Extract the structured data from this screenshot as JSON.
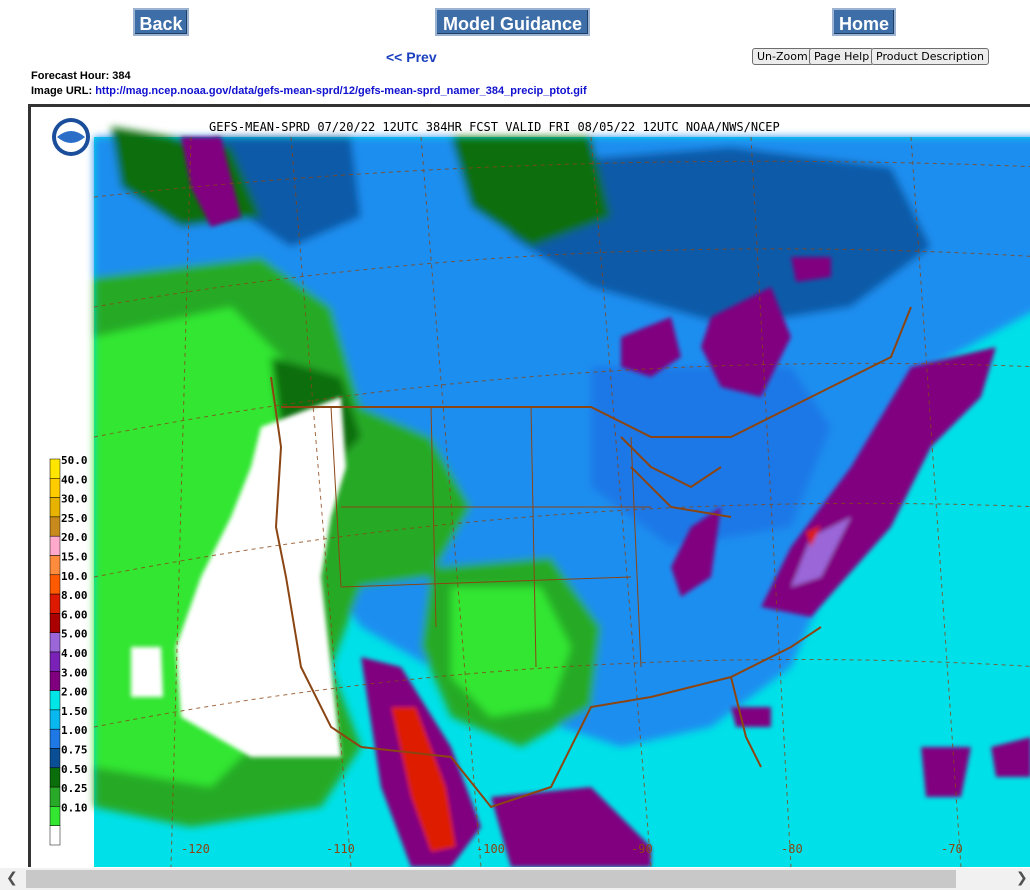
{
  "nav": {
    "back": "Back",
    "model_guidance": "Model Guidance",
    "home": "Home",
    "prev": "<< Prev"
  },
  "buttons": {
    "unzoom": "Un-Zoom",
    "page_help": "Page Help",
    "product_description": "Product Description"
  },
  "info": {
    "forecast_hour": "Forecast Hour: 384",
    "image_url_label": "Image URL:",
    "image_url": "http://mag.ncep.noaa.gov/data/gefs-mean-sprd/12/gefs-mean-sprd_namer_384_precip_ptot.gif"
  },
  "map": {
    "title": "GEFS-MEAN-SPRD 07/20/22 12UTC 384HR FCST VALID FRI 08/05/22 12UTC NOAA/NWS/NCEP",
    "legend": [
      {
        "label": "50.0",
        "color": "#ffe600"
      },
      {
        "label": "40.0",
        "color": "#ffcc00"
      },
      {
        "label": "30.0",
        "color": "#e7b200"
      },
      {
        "label": "25.0",
        "color": "#c88a1c"
      },
      {
        "label": "20.0",
        "color": "#ffaacc"
      },
      {
        "label": "15.0",
        "color": "#ff8c3c"
      },
      {
        "label": "10.0",
        "color": "#ff5a00"
      },
      {
        "label": "8.00",
        "color": "#dd1a00"
      },
      {
        "label": "6.00",
        "color": "#aa0000"
      },
      {
        "label": "5.00",
        "color": "#9a66d8"
      },
      {
        "label": "4.00",
        "color": "#7a22b8"
      },
      {
        "label": "3.00",
        "color": "#800080"
      },
      {
        "label": "2.00",
        "color": "#00e5e5"
      },
      {
        "label": "1.50",
        "color": "#0ab8f0"
      },
      {
        "label": "1.00",
        "color": "#1e78e6"
      },
      {
        "label": "0.75",
        "color": "#0a4f96"
      },
      {
        "label": "0.50",
        "color": "#0a6e0a"
      },
      {
        "label": "0.25",
        "color": "#28aa28"
      },
      {
        "label": "0.10",
        "color": "#32e632"
      },
      {
        "label": "",
        "color": "#ffffff"
      }
    ],
    "longitudes": [
      "-120",
      "-110",
      "-100",
      "-90",
      "-80",
      "-70"
    ]
  },
  "colors": {
    "ocean": "#00e0e8",
    "blue_mid": "#1e8ef0",
    "blue_dark": "#0a5aa8",
    "green_bright": "#32e632",
    "green_mid": "#28aa28",
    "green_dark": "#0a6e0a",
    "white": "#ffffff",
    "purple": "#800080",
    "violet": "#9a66d8",
    "red": "#dd1a00",
    "border": "#8b4513"
  }
}
